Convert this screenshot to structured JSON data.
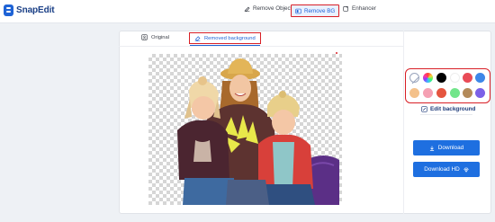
{
  "app": {
    "name": "SnapEdit"
  },
  "nav": [
    {
      "label": "Remove Object",
      "icon": "magic-eraser-icon"
    },
    {
      "label": "Remove BG",
      "icon": "remove-bg-icon",
      "active": true
    },
    {
      "label": "Enhancer",
      "icon": "enhance-icon"
    }
  ],
  "tabs": [
    {
      "label": "Original",
      "icon": "image-icon"
    },
    {
      "label": "Removed background",
      "icon": "eraser-icon",
      "active": true
    }
  ],
  "colors": {
    "accent": "#1e6fe0",
    "highlight_outline": "#d81f26",
    "swatches": [
      "#ffffff",
      "#rainbow",
      "#000000",
      "#ffffff",
      "#e94b57",
      "#3d87e8",
      "#f4c18b",
      "#f5a0b3",
      "#e5553f",
      "#72e58a",
      "#b38a5a",
      "#7b61e8"
    ]
  },
  "panel": {
    "edit_background": "Edit background",
    "download": "Download",
    "download_hd": "Download HD"
  }
}
